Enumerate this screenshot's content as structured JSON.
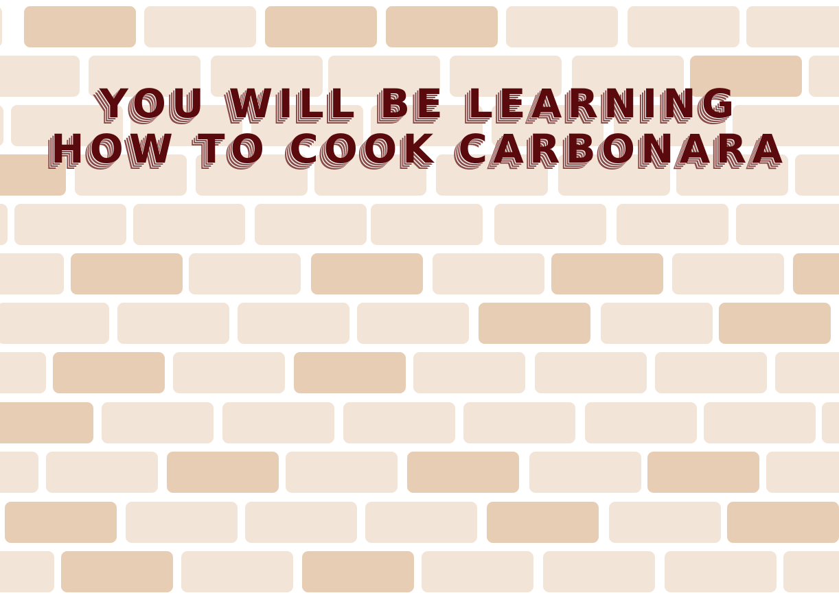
{
  "title": {
    "line1": "YOU WILL BE LEARNING",
    "line2": "HOW TO COOK CARBONARA"
  },
  "colors": {
    "background": "#ffffff",
    "brick_light": "#f2e5d8",
    "brick_dark": "#e7cdb3",
    "title": "#5a0a0c",
    "title_shadow": "#8a4a45"
  }
}
